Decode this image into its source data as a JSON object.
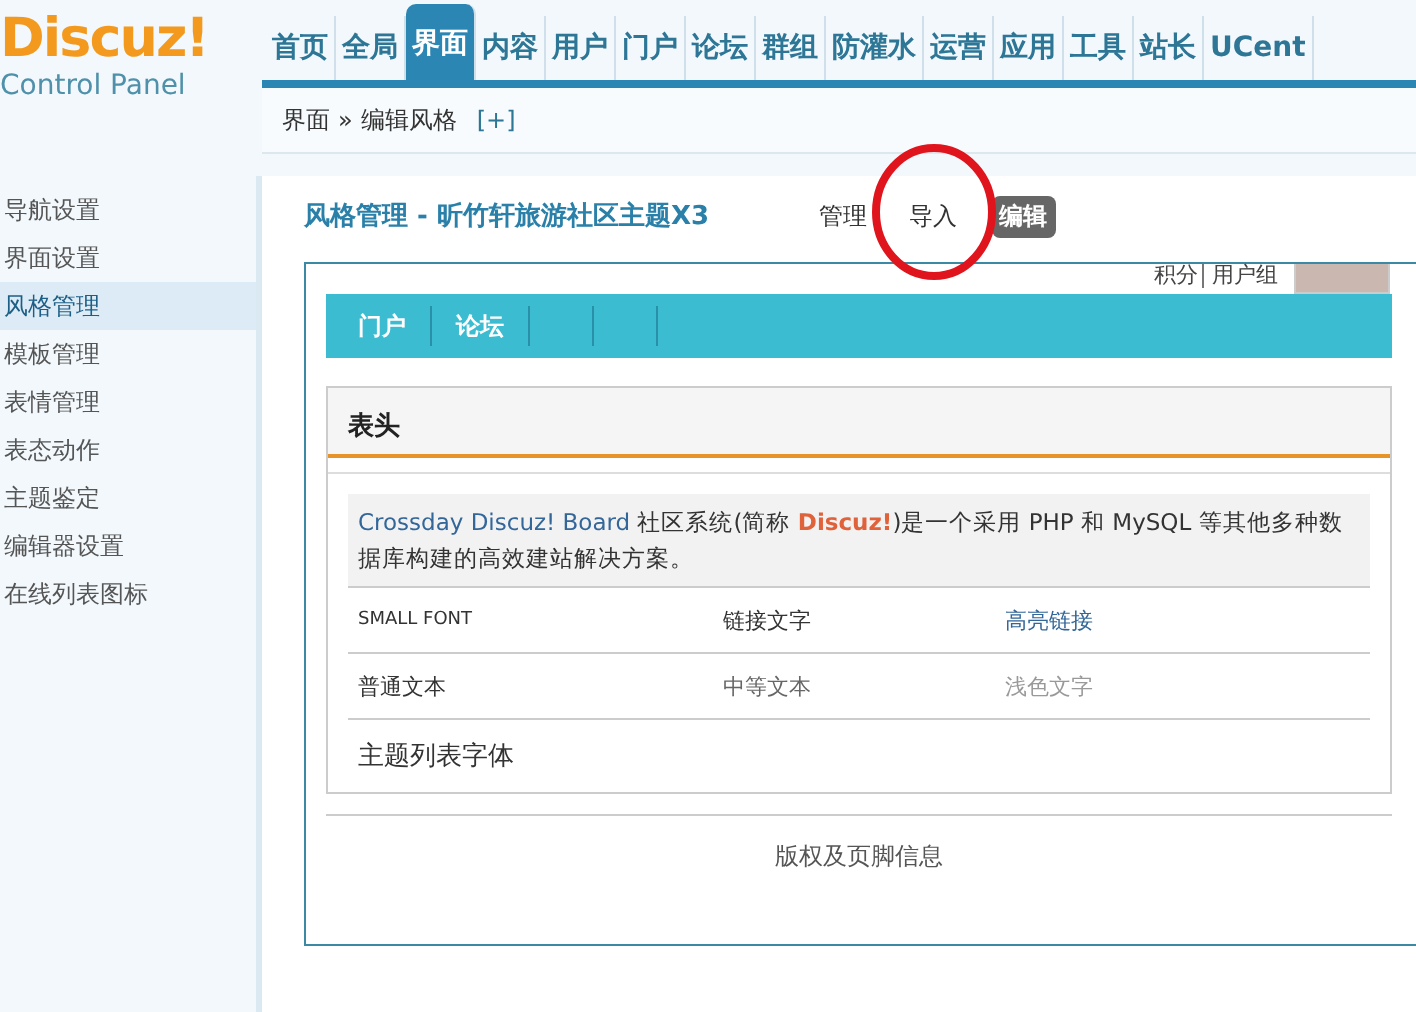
{
  "logo": {
    "title": "Discuz!",
    "subtitle": "Control Panel"
  },
  "nav": [
    {
      "label": "首页",
      "selected": false
    },
    {
      "label": "全局",
      "selected": false
    },
    {
      "label": "界面",
      "selected": true
    },
    {
      "label": "内容",
      "selected": false
    },
    {
      "label": "用户",
      "selected": false
    },
    {
      "label": "门户",
      "selected": false
    },
    {
      "label": "论坛",
      "selected": false
    },
    {
      "label": "群组",
      "selected": false
    },
    {
      "label": "防灌水",
      "selected": false
    },
    {
      "label": "运营",
      "selected": false
    },
    {
      "label": "应用",
      "selected": false
    },
    {
      "label": "工具",
      "selected": false
    },
    {
      "label": "站长",
      "selected": false
    },
    {
      "label": "UCent",
      "selected": false
    }
  ],
  "breadcrumb": {
    "section": "界面",
    "separator": "»",
    "page": "编辑风格",
    "add": "[+]"
  },
  "sidebar": {
    "items": [
      {
        "label": "导航设置",
        "selected": false
      },
      {
        "label": "界面设置",
        "selected": false
      },
      {
        "label": "风格管理",
        "selected": true
      },
      {
        "label": "模板管理",
        "selected": false
      },
      {
        "label": "表情管理",
        "selected": false
      },
      {
        "label": "表态动作",
        "selected": false
      },
      {
        "label": "主题鉴定",
        "selected": false
      },
      {
        "label": "编辑器设置",
        "selected": false
      },
      {
        "label": "在线列表图标",
        "selected": false
      }
    ]
  },
  "page_title": "风格管理 - 昕竹轩旅游社区主题X3",
  "sub_tabs": [
    {
      "label": "管理",
      "selected": false
    },
    {
      "label": "导入",
      "selected": false
    },
    {
      "label": "编辑",
      "selected": true
    }
  ],
  "preview": {
    "user_links": [
      "积分",
      "用户组"
    ],
    "nav": [
      "门户",
      "论坛"
    ],
    "panel_title": "表头",
    "intro": [
      {
        "kind": "link",
        "text": "Crossday Discuz! Board"
      },
      {
        "kind": "plain",
        "text": " 社区系统(简称 "
      },
      {
        "kind": "brand",
        "text": "Discuz!"
      },
      {
        "kind": "plain",
        "text": ")是一个采用 PHP 和 MySQL 等其他多种数据库构建的高效建站解决方案。"
      }
    ],
    "rows": [
      [
        {
          "kind": "small",
          "text": "SMALL FONT"
        },
        {
          "kind": "link",
          "text": "链接文字"
        },
        {
          "kind": "highlight",
          "text": "高亮链接"
        }
      ],
      [
        {
          "kind": "normal",
          "text": "普通文本"
        },
        {
          "kind": "medium",
          "text": "中等文本"
        },
        {
          "kind": "light",
          "text": "浅色文字"
        }
      ],
      [
        {
          "kind": "large",
          "text": "主题列表字体"
        }
      ]
    ],
    "footer": "版权及页脚信息"
  }
}
